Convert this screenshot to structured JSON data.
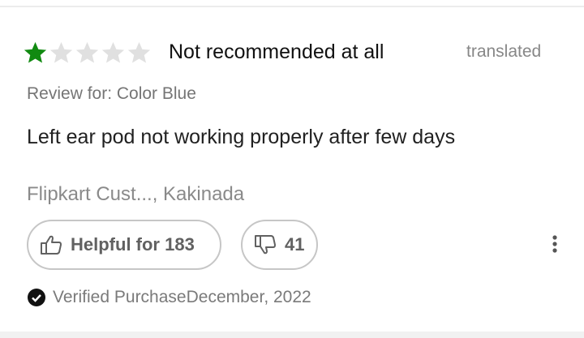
{
  "review": {
    "rating": 1,
    "max_rating": 5,
    "title": "Not recommended at all",
    "translated_label": "translated",
    "review_for": "Review for: Color Blue",
    "body": "Left ear pod not working properly after few days",
    "author": "Flipkart Cust..., Kakinada",
    "helpful_label": "Helpful for 183",
    "dislike_count": "41",
    "verified_label": "Verified Purchase",
    "date": "December, 2022"
  },
  "colors": {
    "star_filled": "#118a11",
    "star_empty": "#e0e0e0",
    "button_border": "#c6c6c6"
  },
  "icons": [
    "star-icon",
    "thumbs-up-icon",
    "thumbs-down-icon",
    "more-vertical-icon",
    "check-circle-icon"
  ]
}
